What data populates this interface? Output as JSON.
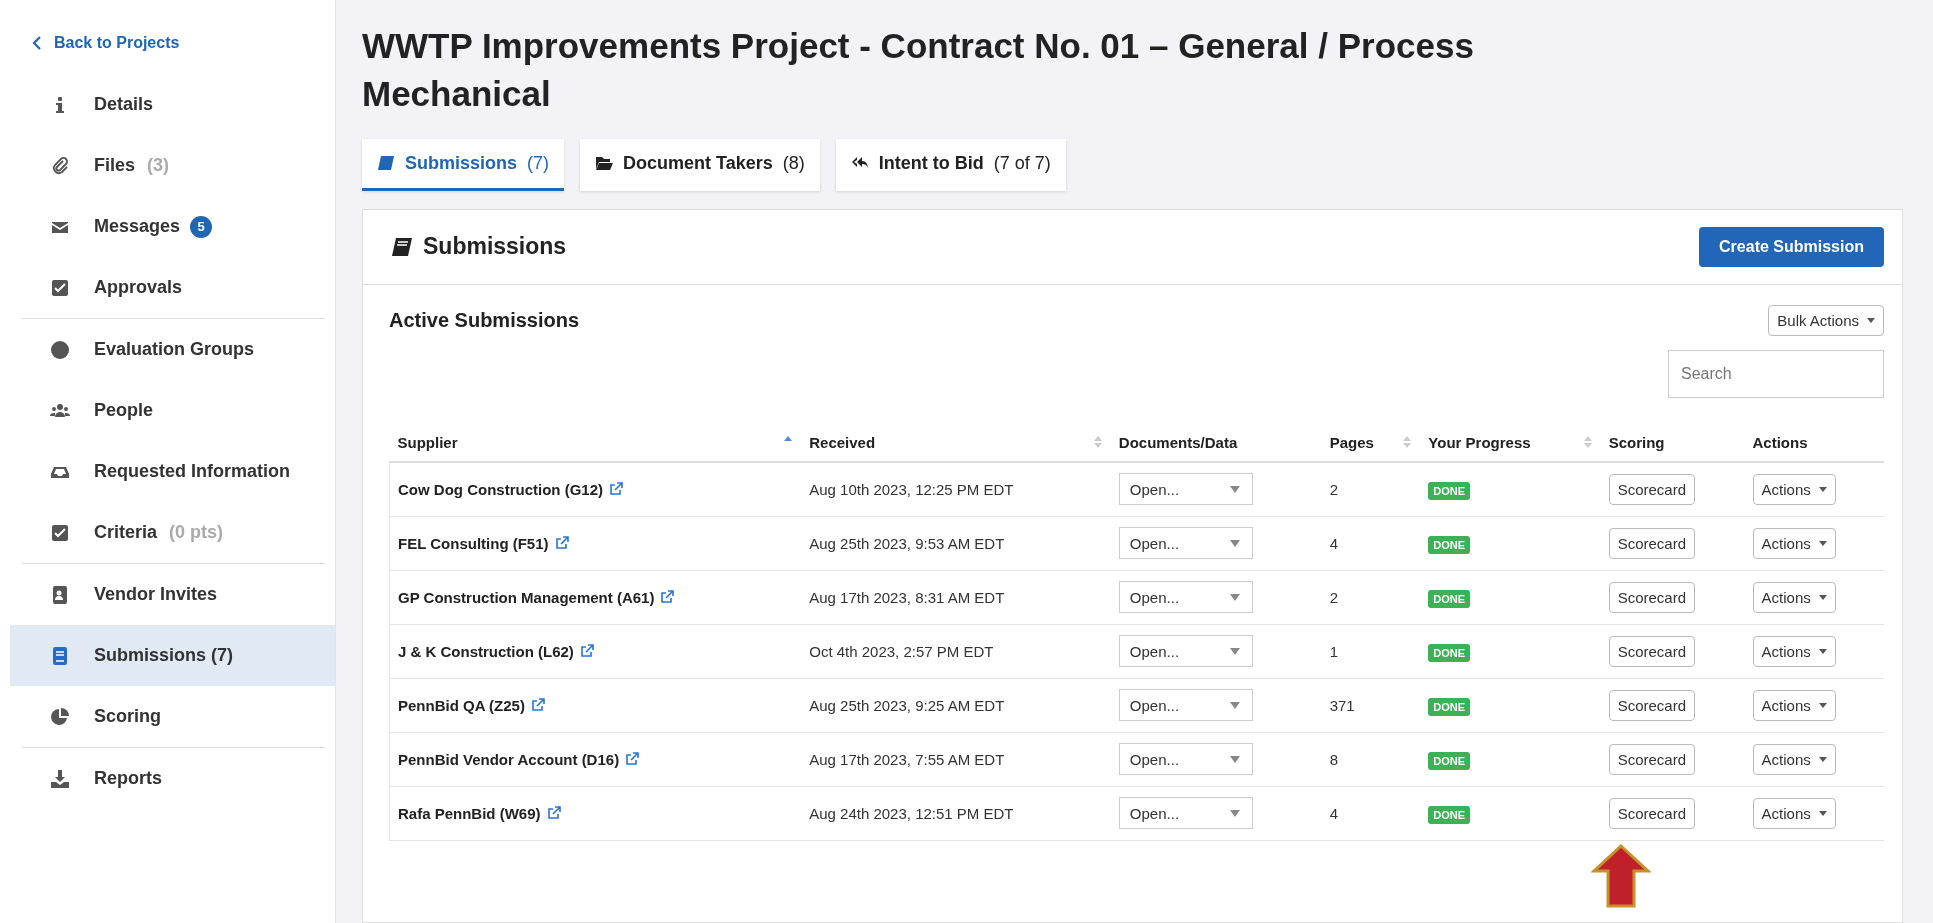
{
  "sidebar": {
    "back_link": "Back to Projects",
    "groups": [
      {
        "items": [
          {
            "label": "Details",
            "selected": false
          },
          {
            "label": "Files",
            "count": "(3)",
            "selected": false
          },
          {
            "label": "Messages",
            "badge": "5",
            "selected": false
          },
          {
            "label": "Approvals",
            "selected": false
          }
        ]
      },
      {
        "items": [
          {
            "label": "Evaluation Groups",
            "selected": false
          },
          {
            "label": "People",
            "selected": false
          },
          {
            "label": "Requested Information",
            "selected": false
          },
          {
            "label": "Criteria",
            "count": "(0 pts)",
            "selected": false
          }
        ]
      },
      {
        "items": [
          {
            "label": "Vendor Invites",
            "selected": false
          },
          {
            "label": "Submissions  (7)",
            "selected": true
          },
          {
            "label": "Scoring",
            "selected": false
          }
        ]
      },
      {
        "items": [
          {
            "label": "Reports",
            "selected": false
          }
        ]
      }
    ]
  },
  "page_title": "WWTP Improvements Project - Contract No. 01 – General / Process Mechanical",
  "tabs": [
    {
      "label": "Submissions",
      "count": "(7)",
      "selected": true
    },
    {
      "label": "Document Takers",
      "count": "(8)",
      "selected": false
    },
    {
      "label": "Intent to Bid",
      "count": "(7 of 7)",
      "selected": false
    }
  ],
  "panel": {
    "title": "Submissions",
    "create_button": "Create Submission",
    "section_title": "Active Submissions",
    "bulk_actions": "Bulk Actions",
    "search": {
      "placeholder": "Search"
    }
  },
  "table": {
    "columns": [
      {
        "label": "Supplier",
        "sorted": true
      },
      {
        "label": "Received",
        "sorted": false
      },
      {
        "label": "Documents/Data"
      },
      {
        "label": "Pages",
        "sorted": false
      },
      {
        "label": "Your Progress",
        "sorted": false
      },
      {
        "label": "Scoring"
      },
      {
        "label": "Actions"
      }
    ],
    "rows": [
      {
        "supplier": "Cow Dog Construction (G12)",
        "received": "Aug 10th 2023, 12:25 PM EDT",
        "documents": "Open...",
        "pages": "2",
        "progress": "DONE",
        "scoring": "Scorecard",
        "actions": "Actions"
      },
      {
        "supplier": "FEL Consulting (F51)",
        "received": "Aug 25th 2023, 9:53 AM EDT",
        "documents": "Open...",
        "pages": "4",
        "progress": "DONE",
        "scoring": "Scorecard",
        "actions": "Actions"
      },
      {
        "supplier": "GP Construction Management (A61)",
        "received": "Aug 17th 2023, 8:31 AM EDT",
        "documents": "Open...",
        "pages": "2",
        "progress": "DONE",
        "scoring": "Scorecard",
        "actions": "Actions"
      },
      {
        "supplier": "J & K Construction (L62)",
        "received": "Oct 4th 2023, 2:57 PM EDT",
        "documents": "Open...",
        "pages": "1",
        "progress": "DONE",
        "scoring": "Scorecard",
        "actions": "Actions"
      },
      {
        "supplier": "PennBid QA (Z25)",
        "received": "Aug 25th 2023, 9:25 AM EDT",
        "documents": "Open...",
        "pages": "371",
        "progress": "DONE",
        "scoring": "Scorecard",
        "actions": "Actions"
      },
      {
        "supplier": "PennBid Vendor Account (D16)",
        "received": "Aug 17th 2023, 7:55 AM EDT",
        "documents": "Open...",
        "pages": "8",
        "progress": "DONE",
        "scoring": "Scorecard",
        "actions": "Actions"
      },
      {
        "supplier": "Rafa PennBid (W69)",
        "received": "Aug 24th 2023, 12:51 PM EDT",
        "documents": "Open...",
        "pages": "4",
        "progress": "DONE",
        "scoring": "Scorecard",
        "actions": "Actions"
      }
    ]
  }
}
